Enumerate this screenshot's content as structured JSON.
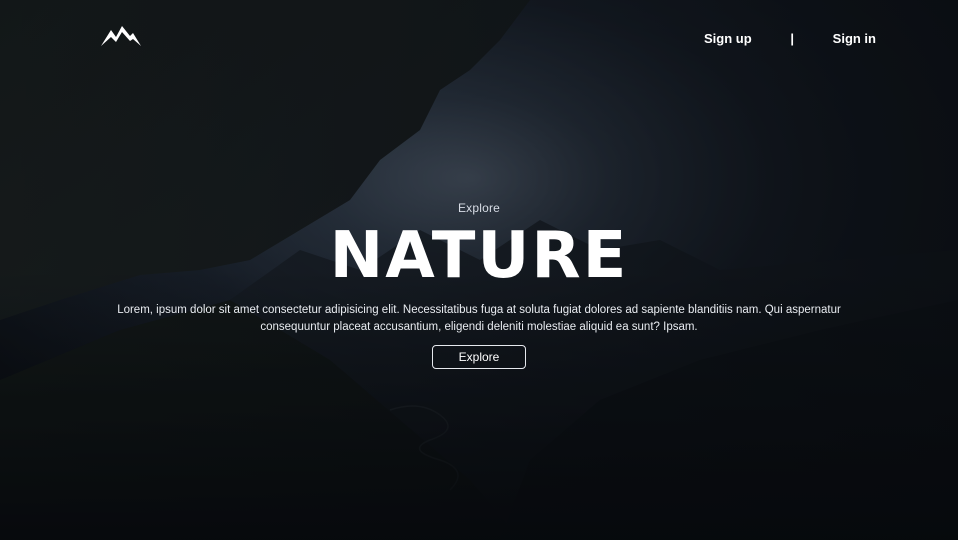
{
  "header": {
    "logo_icon": "mountain-logo-icon",
    "nav": {
      "signup_label": "Sign up",
      "separator": "|",
      "signin_label": "Sign in"
    }
  },
  "hero": {
    "kicker": "Explore",
    "title": "NATURE",
    "description": "Lorem, ipsum dolor sit amet consectetur adipisicing elit. Necessitatibus fuga at soluta fugiat dolores ad sapiente blanditiis nam. Qui aspernatur consequuntur placeat accusantium, eligendi deleniti molestiae aliquid ea sunt? Ipsam.",
    "button_label": "Explore"
  },
  "colors": {
    "overlay": "#0b0e13",
    "text": "#ffffff",
    "button_border": "#e6e9ee"
  }
}
